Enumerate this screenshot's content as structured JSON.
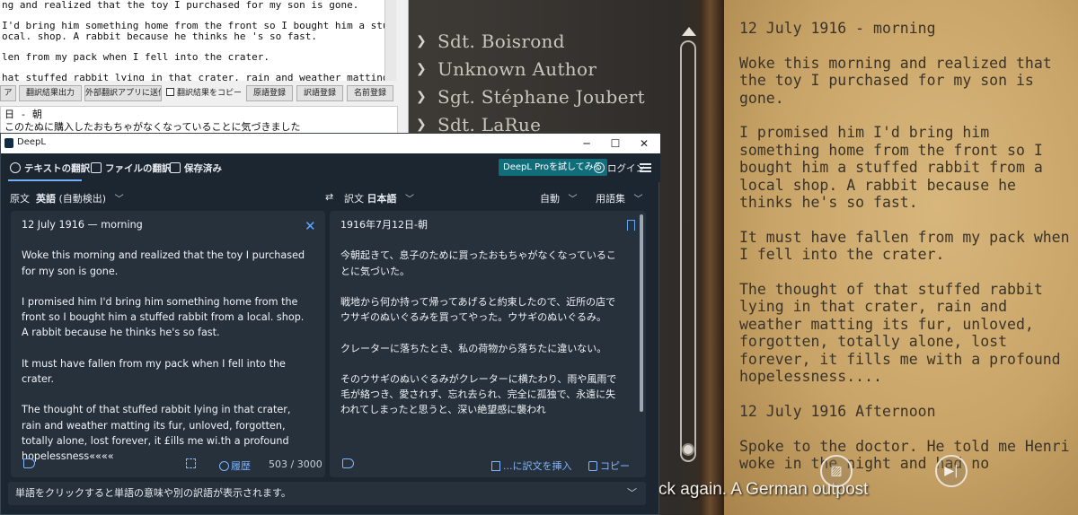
{
  "game": {
    "authors": [
      {
        "name": "Sdt. Boisrond"
      },
      {
        "name": "Unknown Author"
      },
      {
        "name": "Sgt. Stéphane Joubert"
      },
      {
        "name": "Sdt. LaRue"
      }
    ],
    "diary": [
      "12 July 1916 - morning",
      "Woke this morning and realized that the toy I purchased for my son is gone.",
      "I promised him I'd bring him something home from the front so I bought him a stuffed rabbit from a local shop. A rabbit because he thinks he's so fast.",
      "It must have fallen from my pack when I fell into the crater.",
      "The thought of that stuffed rabbit lying in that crater, rain and weather matting its fur, unloved, forgotten, totally alone, lost forever, it fills me with a profound hopelessness....",
      "12 July 1916 Afternoon",
      "Spoke to the doctor. He told me Henri woke in the night and had no"
    ],
    "subtitle": "ck again. A German outpost"
  },
  "tool": {
    "lines": [
      "ng and realized that the toy I purchased for my son is gone.",
      "",
      "I'd bring him something home from the front so I bought him a stuffed",
      "ocal. shop. A rabbit because he thinks he 's so fast.",
      "",
      " len from my pack when I fell into the crater.",
      "",
      "hat stuffed rabbit lying in that crater, rain and weather matting its fur"
    ],
    "buttons": {
      "b0": "ア",
      "b1": "翻訳結果出力",
      "b2": "外部翻訳アプリに送信",
      "check": "翻訳結果をコピー",
      "b3": "原語登録",
      "b4": "訳語登録",
      "b5": "名前登録"
    },
    "lower_lines": [
      " 日 - 朝",
      "このたぬに購入したおもちゃがなくなっていることに気づきました"
    ]
  },
  "deepl": {
    "window_title": "DeepL",
    "nav": {
      "text_tab": "テキストの翻訳",
      "file_tab": "ファイルの翻訳",
      "saved_tab": "保存済み",
      "pro": "DeepL Proを試してみる",
      "login": "ログイン"
    },
    "source_lang_label": "原文",
    "source_lang": "英語",
    "source_lang_detect": "(自動検出)",
    "target_lang_label": "訳文",
    "target_lang": "日本語",
    "formality": "自動",
    "glossary": "用語集",
    "source_text": [
      "12 July 1916 — morning",
      "Woke this morning and realized that the toy I purchased for my son is gone.",
      "I promised him I'd bring him something home from the front so I bought him a stuffed rabbit from a local. shop. A rabbit because he thinks he's so fast.",
      "It must have fallen from my pack when I fell into the crater.",
      "The thought of that stuffed rabbit lying in that crater, rain and weather matting its fur, unloved, forgotten, totally alone, lost forever, it £ills me wi.th a profound hopelessness««««"
    ],
    "target_text": [
      "1916年7月12日-朝",
      "今朝起きて、息子のために買ったおもちゃがなくなっていることに気づいた。",
      "戦地から何か持って帰ってあげると約束したので、近所の店でウサギのぬいぐるみを買ってやった。ウサギのぬいぐるみ。",
      "クレーターに落ちたとき、私の荷物から落ちたに違いない。",
      "そのウサギのぬいぐるみがクレーターに横たわり、雨や風雨で毛が絡つき、愛されず、忘れ去られ、完全に孤独で、永遠に失われてしまったと思うと、深い絶望感に襲われ"
    ],
    "history": "履歴",
    "char_count": "503 / 3000",
    "insert": "...に訳文を挿入",
    "copy": "コピー",
    "hint": "単語をクリックすると単語の意味や別の訳語が表示されます。"
  },
  "colors": {
    "deepl_bg": "#1c2630",
    "panel_bg": "#26313c",
    "accent": "#5fa8ff",
    "pro_button": "#0f6e7a",
    "paper": "#c9a468",
    "ink": "#3a3327"
  }
}
